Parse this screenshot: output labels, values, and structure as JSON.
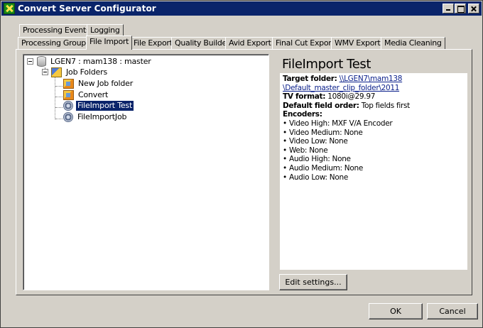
{
  "window": {
    "title": "Convert Server Configurator",
    "app_icon": "converter-x-icon",
    "controls": [
      "minimize-icon",
      "maximize-icon",
      "close-icon"
    ]
  },
  "tabs": {
    "row1": [
      "Processing Events",
      "Logging"
    ],
    "row2": [
      "Processing Groups",
      "File Import",
      "File Export",
      "Quality Builder",
      "Avid Export",
      "Final Cut Export",
      "WMV Export",
      "Media Cleaning"
    ],
    "selected": "File Import"
  },
  "tree": {
    "root": "LGEN7 : mam138 : master",
    "folders": "Job Folders",
    "items": [
      "New Job folder",
      "Convert",
      "FileImport Test",
      "FileImportJob"
    ],
    "selected": "FileImport Test"
  },
  "detail": {
    "title": "FileImport Test",
    "target_folder_label": "Target folder:",
    "target_folder_line1": "\\\\LGEN7\\mam138",
    "target_folder_line2": "\\Default_master_clip_folder\\2011",
    "tv_format_label": "TV format:",
    "tv_format_value": "1080i@29.97",
    "field_order_label": "Default field order:",
    "field_order_value": "Top fields first",
    "encoders_label": "Encoders:",
    "encoders": [
      "Video High: MXF V/A Encoder",
      "Video Medium: None",
      "Video Low: None",
      "Web: None",
      "Audio High: None",
      "Audio Medium: None",
      "Audio Low: None"
    ]
  },
  "buttons": {
    "edit_settings": "Edit settings...",
    "ok": "OK",
    "cancel": "Cancel"
  },
  "colors": {
    "titlebar": "#0a246a",
    "selection": "#0a246a",
    "face": "#d4d0c8",
    "link": "#0a1f8a"
  }
}
